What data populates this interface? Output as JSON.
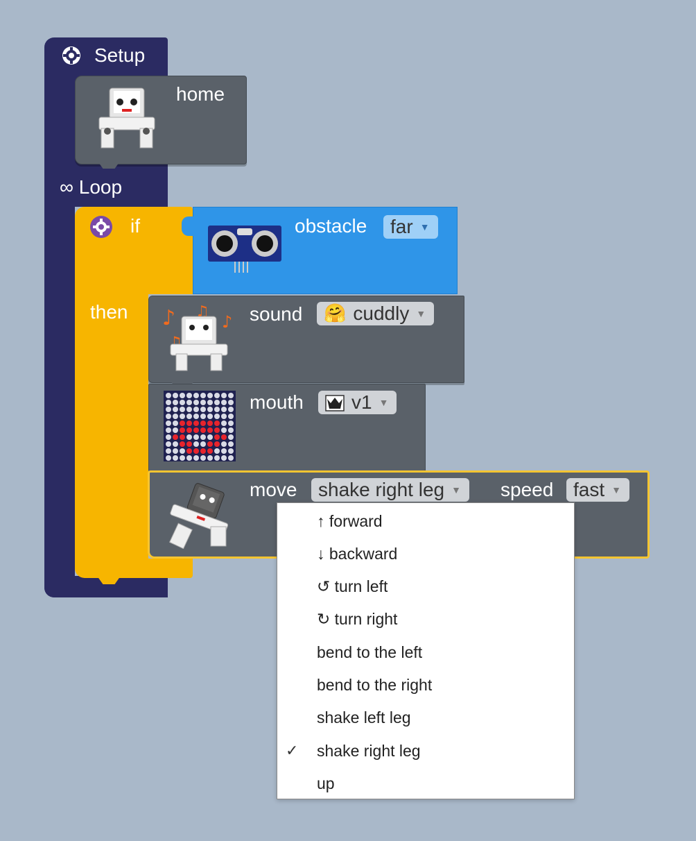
{
  "setup": {
    "label": "Setup",
    "icon": "gear-icon"
  },
  "home": {
    "label": "home",
    "icon": "robot-icon"
  },
  "loop": {
    "label": "∞ Loop"
  },
  "if_block": {
    "if_label": "if",
    "then_label": "then",
    "color": "#f7b500"
  },
  "obstacle": {
    "label": "obstacle",
    "value": "far",
    "icon": "ultrasonic-sensor-icon",
    "color": "#2f95e8"
  },
  "sound": {
    "label": "sound",
    "value": "cuddly",
    "emoji": "🤗",
    "icon": "robot-music-icon"
  },
  "mouth": {
    "label": "mouth",
    "value": "v1",
    "icon": "led-matrix-icon"
  },
  "move": {
    "label": "move",
    "value": "shake right leg",
    "speed_label": "speed",
    "speed_value": "fast",
    "icon": "robot-dancing-icon"
  },
  "move_menu": {
    "items": [
      {
        "label": "↑ forward",
        "selected": false
      },
      {
        "label": "↓ backward",
        "selected": false
      },
      {
        "label": "↺ turn left",
        "selected": false
      },
      {
        "label": "↻ turn right",
        "selected": false
      },
      {
        "label": "bend to the left",
        "selected": false
      },
      {
        "label": "bend to the right",
        "selected": false
      },
      {
        "label": "shake left leg",
        "selected": false
      },
      {
        "label": "shake right leg",
        "selected": true
      },
      {
        "label": "up",
        "selected": false
      }
    ],
    "check_mark": "✓"
  },
  "colors": {
    "background": "#a9b8c9",
    "setup": "#2b2b62",
    "action_block": "#5a6169",
    "dropdown_light": "#d0d3d7"
  }
}
